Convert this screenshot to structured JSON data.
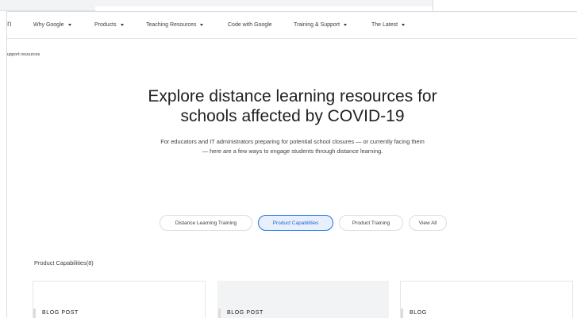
{
  "nav": {
    "logo_fragment": "n",
    "items": [
      {
        "label": "Why Google",
        "dropdown": true
      },
      {
        "label": "Products",
        "dropdown": true
      },
      {
        "label": "Teaching Resources",
        "dropdown": true
      },
      {
        "label": "Code with Google",
        "dropdown": false
      },
      {
        "label": "Training & Support",
        "dropdown": true
      },
      {
        "label": "The Latest",
        "dropdown": true
      }
    ]
  },
  "breadcrumb": "upport resources",
  "hero": {
    "title_line1": "Explore distance learning resources for",
    "title_line2": "schools affected by COVID-19",
    "subtitle_line1": "For educators and IT administrators preparing for potential school closures — or currently facing them",
    "subtitle_line2": "— here are a few ways to engage students through distance learning."
  },
  "filters": [
    {
      "label": "Distance Learning Training",
      "active": false
    },
    {
      "label": "Product Capabilities",
      "active": true
    },
    {
      "label": "Product Training",
      "active": false
    },
    {
      "label": "View All",
      "active": false
    }
  ],
  "section_label": "Product Capabilities(8)",
  "cards": [
    {
      "tag": "BLOG POST"
    },
    {
      "tag": "BLOG POST"
    },
    {
      "tag": "BLOG"
    }
  ],
  "colors": {
    "accent": "#1a73e8",
    "active_pill_bg": "#e8f0fe",
    "text": "#202124",
    "muted": "#3c4043"
  }
}
